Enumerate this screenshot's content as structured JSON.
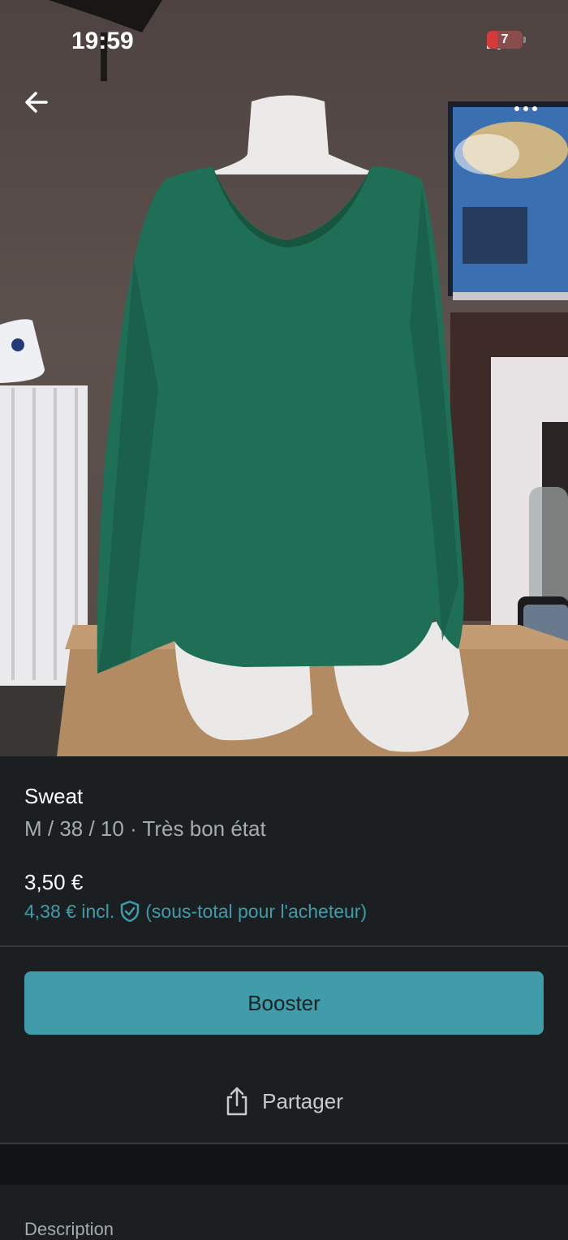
{
  "status_bar": {
    "time": "19:59",
    "battery_level": "7",
    "icons": [
      "cellular-signal-icon",
      "wifi-icon",
      "battery-icon"
    ]
  },
  "navigation": {
    "back_icon": "arrow-left-icon",
    "more_icon": "more-horizontal-icon"
  },
  "item": {
    "title": "Sweat",
    "subtitle": "M / 38 / 10 · Très bon état",
    "price": "3,50 €",
    "price_incl_amount": "4,38 € incl.",
    "price_incl_note": "(sous-total pour l'acheteur)",
    "protection_icon": "shield-check-icon"
  },
  "actions": {
    "boost_label": "Booster",
    "share_label": "Partager",
    "share_icon": "share-icon"
  },
  "sections": {
    "description_heading": "Description"
  },
  "colors": {
    "accent": "#3f9ca8",
    "background": "#1b1f21",
    "sweater": "#1f6e56"
  }
}
